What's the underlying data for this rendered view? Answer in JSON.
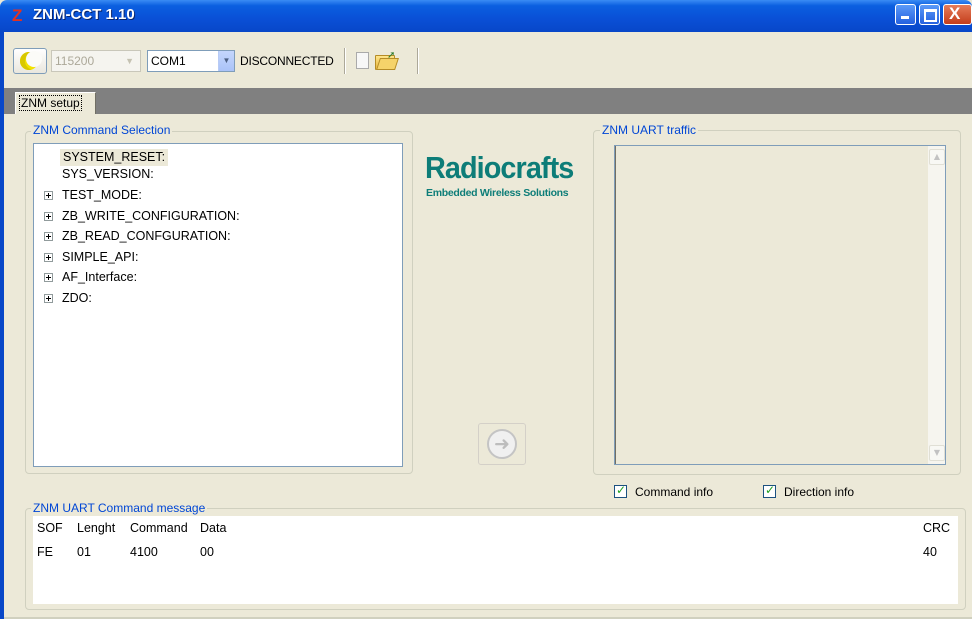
{
  "window": {
    "app_icon": "Z",
    "title": "ZNM-CCT 1.10",
    "controls": [
      "minimize-icon",
      "maximize-icon",
      "close-icon"
    ],
    "close_glyph": "X"
  },
  "toolbar": {
    "connect_icon": "moon-icon",
    "baud_rate": "115200",
    "com_port": "COM1",
    "status": "DISCONNECTED",
    "clear_icon": "clear-log-icon",
    "open_icon": "open-folder-icon"
  },
  "tabs": [
    {
      "label": "ZNM setup",
      "selected": true
    }
  ],
  "command_selection": {
    "title": "ZNM Command Selection",
    "items": [
      {
        "label": "SYSTEM_RESET:",
        "expandable": false,
        "selected": true
      },
      {
        "label": "SYS_VERSION:",
        "expandable": false
      },
      {
        "label": "TEST_MODE:",
        "expandable": true
      },
      {
        "label": "ZB_WRITE_CONFIGURATION:",
        "expandable": true
      },
      {
        "label": "ZB_READ_CONFGURATION:",
        "expandable": true
      },
      {
        "label": "SIMPLE_API:",
        "expandable": true
      },
      {
        "label": "AF_Interface:",
        "expandable": true
      },
      {
        "label": "ZDO:",
        "expandable": true
      }
    ]
  },
  "logo": {
    "name": "Radiocrafts",
    "tagline": "Embedded Wireless Solutions",
    "color": "#0d7d78"
  },
  "send_button": {
    "icon": "arrow-right-circle-icon",
    "enabled": false
  },
  "uart_traffic": {
    "title": "ZNM UART traffic",
    "options": [
      {
        "label": "Command info",
        "checked": true
      },
      {
        "label": "Direction info",
        "checked": true
      }
    ]
  },
  "command_message": {
    "title": "ZNM UART Command message",
    "headers": {
      "sof": "SOF",
      "length": "Lenght",
      "command": "Command",
      "data": "Data",
      "crc": "CRC"
    },
    "values": {
      "sof": "FE",
      "length": "01",
      "command": "4100",
      "data": "00",
      "crc": "40"
    }
  },
  "colors": {
    "titlebar": "#0a4fd6",
    "group_title": "#0046d5",
    "window_bg": "#ece9d8",
    "tab_strip": "#808080"
  }
}
